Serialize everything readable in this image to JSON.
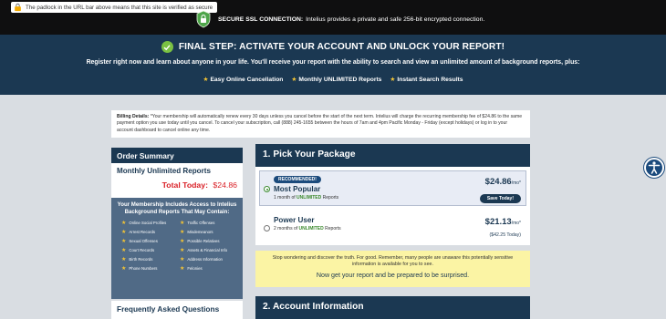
{
  "topbar": {
    "padlock_tip": "The padlock in the URL bar above means that this site is verified as secure",
    "ssl_title": "SECURE SSL CONNECTION:",
    "ssl_text": "Intelius provides a private and safe 256-bit encrypted connection."
  },
  "hero": {
    "title": "FINAL STEP: ACTIVATE YOUR ACCOUNT AND UNLOCK YOUR REPORT!",
    "subtitle": "Register right now and learn about anyone in your life. You'll receive your report with the ability to search and view an unlimited amount of background reports, plus:",
    "perks": [
      "Easy Online Cancellation",
      "Monthly UNLIMITED Reports",
      "Instant Search Results"
    ]
  },
  "billing": {
    "label": "Billing Details:",
    "text": "*Your membership will automatically renew every 30 days unless you cancel before the start of the next term. Intelius will charge the recurring membership fee of $24.86 to the same payment option you use today until you cancel. To cancel your subscription, call (888) 245-1655 between the hours of 7am and 4pm Pacific Monday - Friday (except holidays) or log in to your account dashboard to cancel online any time."
  },
  "order": {
    "title": "Order Summary",
    "plan": "Monthly Unlimited Reports",
    "total_label": "Total Today:",
    "total_value": "$24.86",
    "access_title": "Your Membership Includes Access to Intelius Background Reports That May Contain:",
    "access_items": [
      "Online Social Profiles",
      "Traffic Offenses",
      "Arrest Records",
      "Misdemeanors",
      "Sexual Offenses",
      "Possible Relatives",
      "Court Records",
      "Assets & Financial Info",
      "Birth Records",
      "Address Information",
      "Phone Numbers",
      "Felonies"
    ]
  },
  "faq": {
    "title": "Frequently Asked Questions"
  },
  "pick": {
    "title": "1. Pick Your Package",
    "packages": [
      {
        "badge": "RECOMMENDED!",
        "name": "Most Popular",
        "desc_prefix": "1 month of",
        "desc_highlight": "UNLIMITED",
        "desc_suffix": "Reports",
        "price": "$24.86",
        "per": "/mo*",
        "button": "Save Today!"
      },
      {
        "name": "Power User",
        "desc_prefix": "2 months of",
        "desc_highlight": "UNLIMITED",
        "desc_suffix": "Reports",
        "price": "$21.13",
        "per": "/mo*",
        "sub": "($42.25 Today)"
      }
    ]
  },
  "alert": {
    "text": "Stop wondering and discover the truth. For good. Remember, many people are unaware this potentially sensitive information is available for you to see.",
    "cta": "Now get your report and be prepared to be surprised."
  },
  "account": {
    "title": "2. Account Information"
  },
  "colors": {
    "navy": "#1b3852",
    "slate": "#506a86",
    "red": "#d91f26",
    "green": "#7ac142",
    "star": "#f2c335",
    "alert_bg": "#fbf4a4"
  },
  "icons": [
    "lock-icon",
    "shield-icon",
    "check-icon",
    "star-icon",
    "accessibility-icon"
  ]
}
